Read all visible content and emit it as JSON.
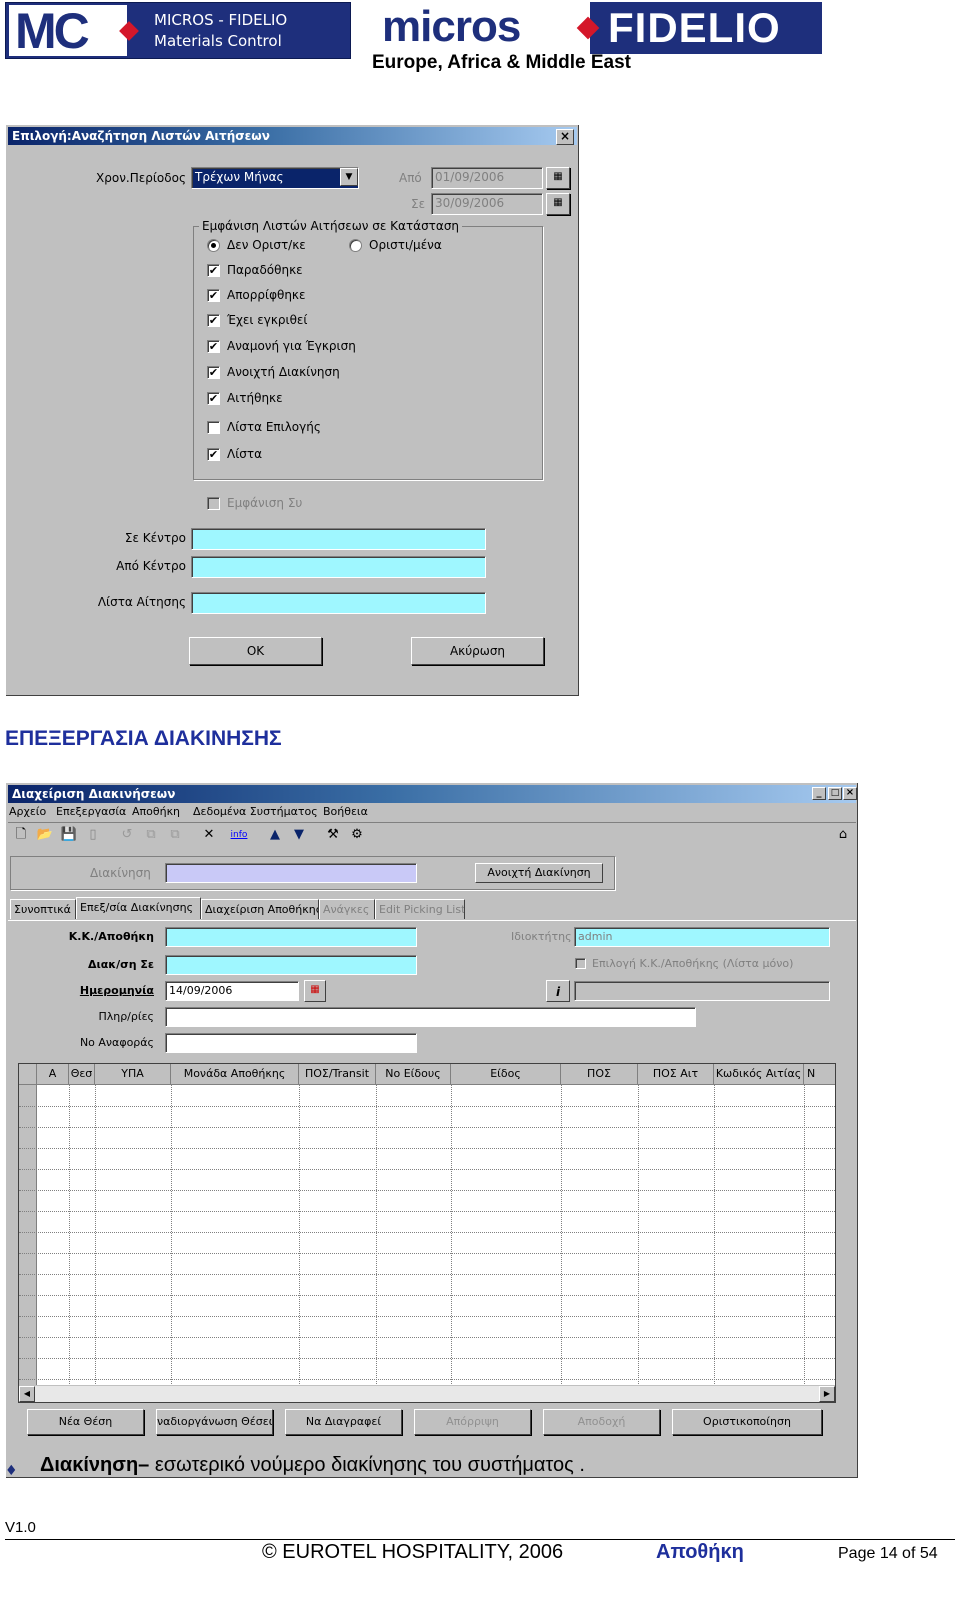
{
  "header": {
    "mc_logo": "MC",
    "mc_line1": "MICROS - FIDELIO",
    "mc_line2": "Materials Control",
    "micros_word": "micros",
    "fidelio_word": "FIDELIO",
    "region": "Europe, Africa & Middle East"
  },
  "dialog1": {
    "title": "Επιλογή:Αναζήτηση Λιστών Αιτήσεων",
    "close": "×",
    "period_label": "Χρον.Περίοδος",
    "period_value": "Τρέχων Μήνας",
    "from_label": "Από",
    "from_value": "01/09/2006",
    "to_label": "Σε",
    "to_value": "30/09/2006",
    "group_title": "Εμφάνιση Λιστών Αιτήσεων σε Κατάσταση",
    "radio_unfinalized": "Δεν Οριστ/κε",
    "radio_finalized": "Οριστι/μένα",
    "checks": [
      {
        "label": "Παραδόθηκε",
        "mark": "✔"
      },
      {
        "label": "Απορρίφθηκε",
        "mark": "✔"
      },
      {
        "label": "Έχει εγκριθεί",
        "mark": "✔"
      },
      {
        "label": "Αναμονή για Έγκριση",
        "mark": "✔"
      },
      {
        "label": "Ανοιχτή Διακίνηση",
        "mark": "✔"
      },
      {
        "label": "Αιτήθηκε",
        "mark": "✔"
      },
      {
        "label": "Λίστα Επιλογής",
        "mark": ""
      },
      {
        "label": "Λίστα",
        "mark": "✔"
      }
    ],
    "show_sum": "Εμφάνιση Συ",
    "to_center_label": "Σε Κέντρο",
    "from_center_label": "Από Κέντρο",
    "request_list_label": "Λίστα Αίτησης",
    "ok": "OK",
    "cancel": "Ακύρωση"
  },
  "section_heading": "ΕΠΕΞΕΡΓΑΣΙΑ ΔΙΑΚΙΝΗΣΗΣ",
  "window2": {
    "title": "Διαχείριση Διακινήσεων",
    "menu": [
      "Αρχείο",
      "Επεξεργασία",
      "Αποθήκη",
      "Δεδομένα Συστήματος",
      "Βοήθεια"
    ],
    "transfer_label": "Διακίνηση",
    "open_transfer_btn": "Ανοιχτή Διακίνηση",
    "tabs": [
      "Συνοπτικά",
      "Επεξ/σία Διακίνησης",
      "Διαχείριση Αποθήκης",
      "Ανάγκες",
      "Edit Picking List"
    ],
    "cc_label": "Κ.Κ./Αποθήκη",
    "owner_label": "Ιδιοκτήτης",
    "owner_value": "admin",
    "transfer_to_label": "Διακ/ση Σε",
    "select_cc_label": "Επιλογή Κ.Κ./Αποθήκης (Λίστα μόνο)",
    "date_label": "Ημερομηνία",
    "date_value": "14/09/2006",
    "info_btn": "i",
    "info_label": "info",
    "notes_label": "Πληρ/ρίες",
    "ref_label": "Νο Αναφοράς",
    "columns": [
      "A",
      "Θεσ",
      "ΥΠΑ",
      "Μονάδα Αποθήκης",
      "ΠΟΣ/Transit",
      "Νο Είδους",
      "Είδος",
      "ΠΟΣ",
      "ΠΟΣ Αιτ",
      "Κωδικός Αιτίας",
      "Ν"
    ],
    "buttons": {
      "new_pos": "Νέα Θέση",
      "rearrange": "ναδιοργάνωση Θέσεω",
      "delete": "Να Διαγραφεί",
      "reject": "Απόρριψη",
      "accept": "Αποδοχή",
      "finalize": "Οριστικοποίηση"
    }
  },
  "bullet": {
    "mark": "♦",
    "term": "Διακίνηση–",
    "text": " εσωτερικό νούμερο διακίνησης του συστήματος ."
  },
  "footer": {
    "version": "V1.0",
    "copyright": "© EUROTEL HOSPITALITY, 2006",
    "dept": "Αποθήκη",
    "page": "Page 14 of 54"
  }
}
